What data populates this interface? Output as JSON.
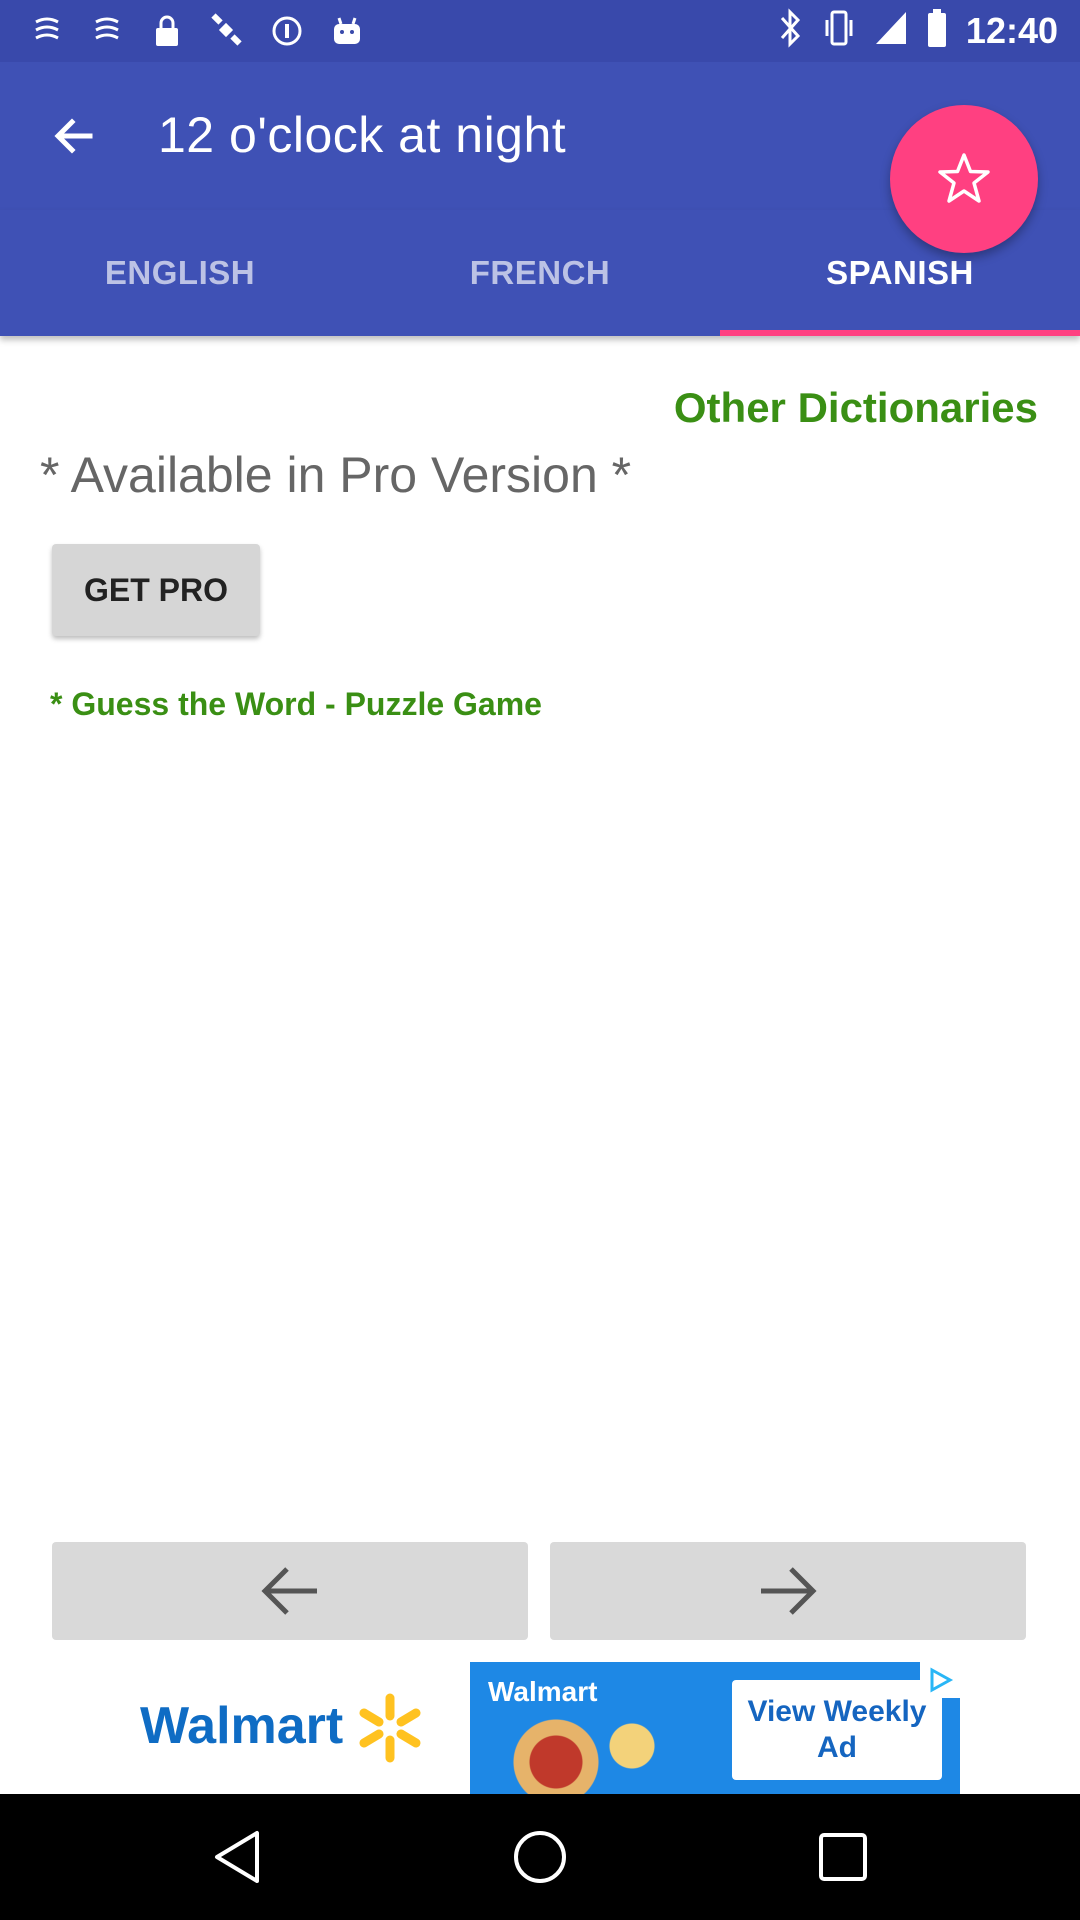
{
  "status_bar": {
    "time": "12:40",
    "left_icons": [
      "notification-icon",
      "notification-icon",
      "lock-icon",
      "satellite-icon",
      "info-icon",
      "android-icon"
    ],
    "right_icons": [
      "bluetooth-icon",
      "vibrate-icon",
      "signal-icon",
      "battery-icon"
    ]
  },
  "app_bar": {
    "title": "12 o'clock at night",
    "back_icon": "back-arrow-icon"
  },
  "tabs": [
    {
      "label": "ENGLISH",
      "active": false
    },
    {
      "label": "FRENCH",
      "active": false
    },
    {
      "label": "SPANISH",
      "active": true
    }
  ],
  "fab": {
    "icon": "star-icon",
    "color": "#ff4081"
  },
  "content": {
    "other_dictionaries": "Other Dictionaries",
    "pro_notice": "* Available in Pro Version *",
    "get_pro_label": "GET PRO",
    "puzzle_link": "* Guess the Word - Puzzle Game"
  },
  "nav": {
    "prev_icon": "arrow-left-icon",
    "next_icon": "arrow-right-icon"
  },
  "ad": {
    "brand": "Walmart",
    "mini_brand": "Walmart",
    "cta": "View Weekly Ad"
  },
  "colors": {
    "primary": "#3f51b5",
    "primary_dark": "#3949ab",
    "accent": "#ff4081",
    "link_green": "#3a8f14"
  }
}
